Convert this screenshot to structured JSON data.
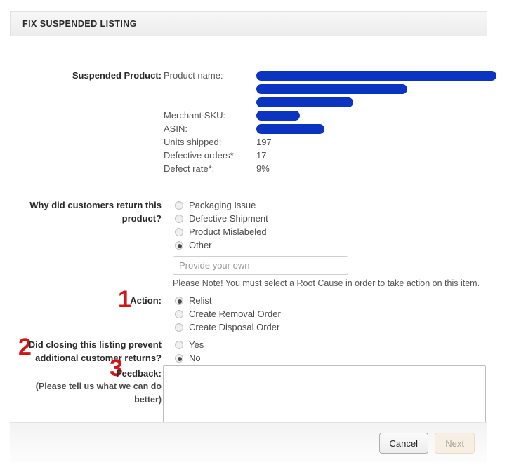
{
  "panel": {
    "header_title": "FIX SUSPENDED LISTING"
  },
  "product": {
    "label": "Suspended Product:",
    "rows": [
      {
        "key": "Product name:",
        "value": "",
        "redacted": true
      },
      {
        "key": "",
        "value": "",
        "redacted": true
      },
      {
        "key": "",
        "value": "",
        "redacted": true
      },
      {
        "key": "Merchant SKU:",
        "value": "",
        "redacted": true
      },
      {
        "key": "ASIN:",
        "value": "",
        "redacted": true
      },
      {
        "key": "Units shipped:",
        "value": "197",
        "redacted": false
      },
      {
        "key": "Defective orders*:",
        "value": "17",
        "redacted": false
      },
      {
        "key": "Defect rate*:",
        "value": "9%",
        "redacted": false
      }
    ]
  },
  "why_return": {
    "label": "Why did customers return this product?",
    "options": [
      {
        "label": "Packaging Issue",
        "checked": false
      },
      {
        "label": "Defective Shipment",
        "checked": false
      },
      {
        "label": "Product Mislabeled",
        "checked": false
      },
      {
        "label": "Other",
        "checked": true
      }
    ],
    "other_input": {
      "value": "",
      "placeholder": "Provide your own"
    },
    "note": "Please Note! You must select a Root Cause in order to take action on this item."
  },
  "action": {
    "step_number": "1",
    "label": "Action:",
    "options": [
      {
        "label": "Relist",
        "checked": true
      },
      {
        "label": "Create Removal Order",
        "checked": false
      },
      {
        "label": "Create Disposal Order",
        "checked": false
      }
    ]
  },
  "prevent_returns": {
    "step_number": "2",
    "label": "Did closing this listing prevent additional customer returns?",
    "options": [
      {
        "label": "Yes",
        "checked": false
      },
      {
        "label": "No",
        "checked": true
      }
    ]
  },
  "feedback": {
    "step_number": "3",
    "label": "Feedback:",
    "sublabel": "(Please tell us what we can do better)",
    "value": "",
    "placeholder": ""
  },
  "footer": {
    "cancel_label": "Cancel",
    "next_label": "Next"
  },
  "colors": {
    "redaction_blue": "#0b34c0",
    "step_red": "#cf1515",
    "next_disabled_bg": "#f6efe2"
  }
}
